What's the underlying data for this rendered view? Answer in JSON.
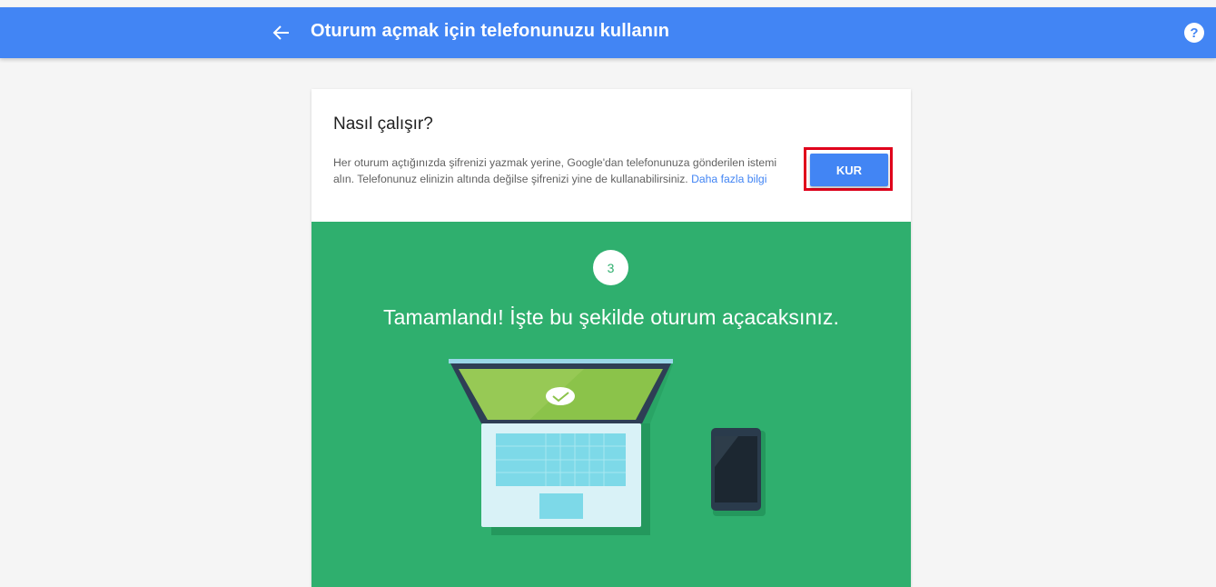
{
  "appbar": {
    "back_icon": "arrow-back-icon",
    "title": "Oturum açmak için telefonunuzu kullanın",
    "help_icon": "help-circle-icon",
    "help_glyph": "?"
  },
  "card": {
    "heading": "Nasıl çalışır?",
    "description": "Her oturum açtığınızda şifrenizi yazmak yerine, Google'dan telefonunuza gönderilen istemi alın. Telefonunuz elinizin altında değilse şifrenizi yine de kullanabilirsiniz.",
    "learn_more_link": "Daha fazla bilgi",
    "setup_button": "KUR"
  },
  "step": {
    "number": "3",
    "message": "Tamamlandı! İşte bu şekilde oturum açacaksınız."
  },
  "colors": {
    "appbar": "#4285f4",
    "accent_green": "#2faf6e",
    "highlight": "#e0001b",
    "link": "#4285f4"
  }
}
